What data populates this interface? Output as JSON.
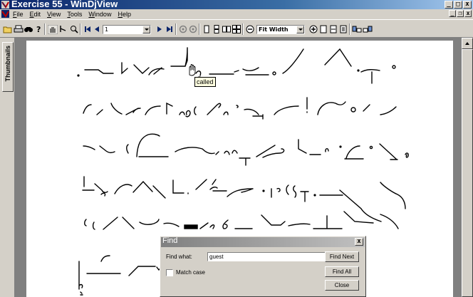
{
  "window": {
    "title": "Exercise 55 - WinDjView",
    "caption_min": "_",
    "caption_max": "□",
    "caption_close": "x"
  },
  "menubar": {
    "items": [
      {
        "label": "File",
        "mnemonic": "F"
      },
      {
        "label": "Edit",
        "mnemonic": "E"
      },
      {
        "label": "View",
        "mnemonic": "V"
      },
      {
        "label": "Tools",
        "mnemonic": "T"
      },
      {
        "label": "Window",
        "mnemonic": "W"
      },
      {
        "label": "Help",
        "mnemonic": "H"
      }
    ],
    "mdi_min": "_",
    "mdi_restore": "❐",
    "mdi_close": "x"
  },
  "toolbar": {
    "page_number": "1",
    "zoom": "Fit Width"
  },
  "sidebar": {
    "tab_label": "Thumbnails"
  },
  "tooltip": {
    "text": "called"
  },
  "find_dialog": {
    "title": "Find",
    "close": "x",
    "find_what_label": "Find what:",
    "find_what_value": "guest",
    "match_case_label": "Match case",
    "find_next_label": "Find Next",
    "find_all_label": "Find All",
    "close_label": "Close"
  },
  "colors": {
    "title_active": "#0a246a",
    "title_inactive": "#808080",
    "face": "#d4d0c8",
    "tooltip_bg": "#ffffe1"
  }
}
